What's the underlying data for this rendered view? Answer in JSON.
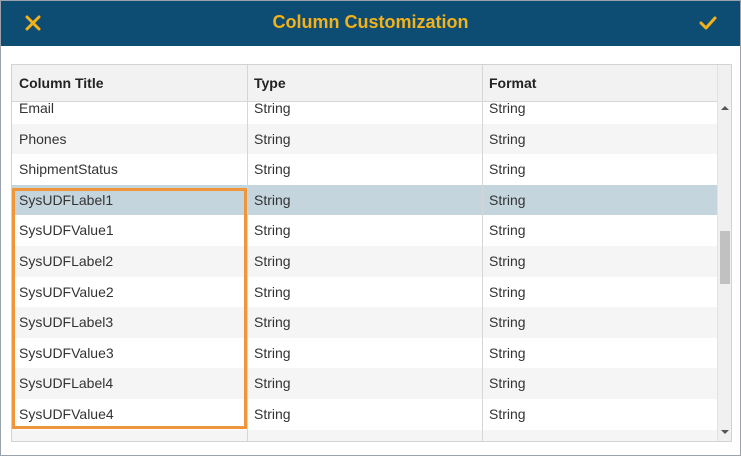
{
  "dialog": {
    "title": "Column Customization",
    "close_icon": "close-icon",
    "confirm_icon": "checkmark-icon",
    "colors": {
      "titlebar": "#0e4d73",
      "accent": "#f3b21a",
      "selected_row": "#c4d5de",
      "highlight": "#f0963a"
    }
  },
  "grid": {
    "columns": [
      "Column Title",
      "Type",
      "Format"
    ],
    "rows": [
      [
        "Email",
        "String",
        "String"
      ],
      [
        "Phones",
        "String",
        "String"
      ],
      [
        "ShipmentStatus",
        "String",
        "String"
      ],
      [
        "SysUDFLabel1",
        "String",
        "String"
      ],
      [
        "SysUDFValue1",
        "String",
        "String"
      ],
      [
        "SysUDFLabel2",
        "String",
        "String"
      ],
      [
        "SysUDFValue2",
        "String",
        "String"
      ],
      [
        "SysUDFLabel3",
        "String",
        "String"
      ],
      [
        "SysUDFValue3",
        "String",
        "String"
      ],
      [
        "SysUDFLabel4",
        "String",
        "String"
      ],
      [
        "SysUDFValue4",
        "String",
        "String"
      ],
      [
        "",
        "",
        ""
      ]
    ],
    "selected_row": "SysUDFLabel1",
    "scroll_up_icon": "scroll-up-arrow-icon",
    "scroll_down_icon": "scroll-down-arrow-icon"
  }
}
